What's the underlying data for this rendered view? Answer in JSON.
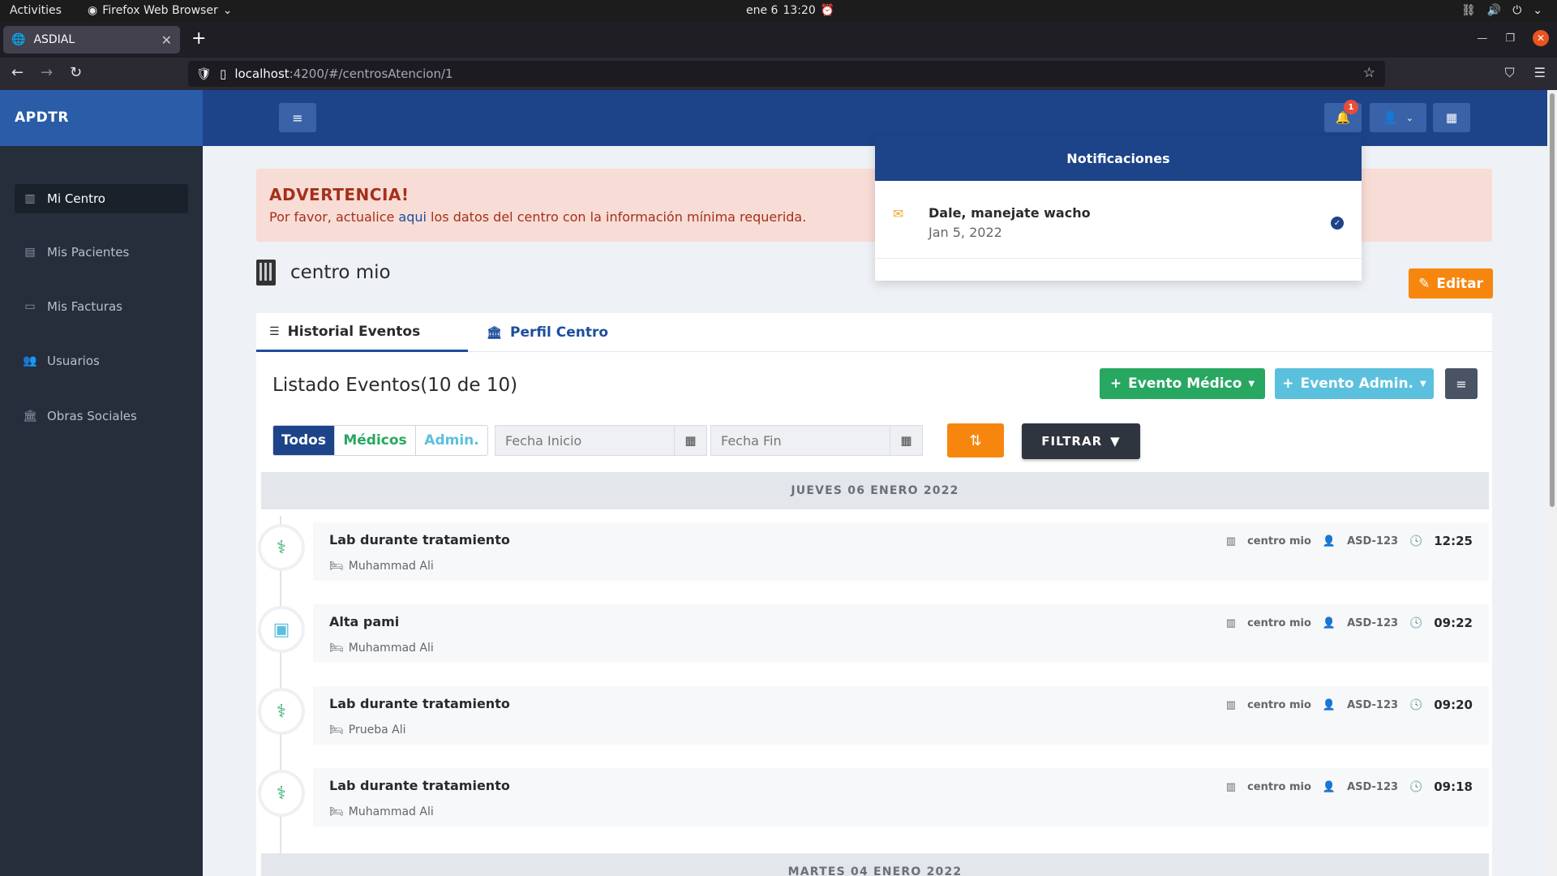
{
  "system": {
    "activities": "Activities",
    "app_name": "Firefox Web Browser",
    "date": "ene 6",
    "time": "13:20"
  },
  "browser": {
    "tab_title": "ASDIAL",
    "url_host": "localhost",
    "url_path": ":4200/#/centrosAtencion/1"
  },
  "header": {
    "brand": "APDTR",
    "notif_count": "1"
  },
  "sidebar": {
    "items": [
      {
        "label": "Mi Centro",
        "icon": "building-icon",
        "active": true
      },
      {
        "label": "Mis Pacientes",
        "icon": "id-card-icon",
        "active": false
      },
      {
        "label": "Mis Facturas",
        "icon": "credit-card-icon",
        "active": false
      },
      {
        "label": "Usuarios",
        "icon": "users-icon",
        "active": false
      },
      {
        "label": "Obras Sociales",
        "icon": "bank-icon",
        "active": false
      }
    ]
  },
  "alert": {
    "title": "ADVERTENCIA!",
    "msg_before": "Por favor, actualice ",
    "link": "aqui",
    "msg_after": " los datos del centro con la información mínima requerida."
  },
  "center": {
    "name": "centro mio",
    "edit_label": "Editar"
  },
  "tabs": {
    "historial": "Historial Eventos",
    "perfil": "Perfil Centro"
  },
  "list": {
    "title": "Listado Eventos(10 de 10)",
    "btn_medico": "Evento Médico",
    "btn_admin": "Evento Admin.",
    "filter_todos": "Todos",
    "filter_medicos": "Médicos",
    "filter_admin": "Admin.",
    "fecha_inicio_placeholder": "Fecha Inicio",
    "fecha_fin_placeholder": "Fecha Fin",
    "filtrar_label": "FILTRAR"
  },
  "days": [
    {
      "label": "JUEVES 06 ENERO 2022"
    },
    {
      "label": "MARTES 04 ENERO 2022"
    }
  ],
  "events": [
    {
      "title": "Lab durante tratamiento",
      "patient": "Muhammad Ali",
      "center": "centro mio",
      "code": "ASD-123",
      "time": "12:25",
      "type": "medico",
      "icon": "stethoscope-icon"
    },
    {
      "title": "Alta pami",
      "patient": "Muhammad Ali",
      "center": "centro mio",
      "code": "ASD-123",
      "time": "09:22",
      "type": "admin",
      "icon": "contact-card-icon"
    },
    {
      "title": "Lab durante tratamiento",
      "patient": "Prueba Ali",
      "center": "centro mio",
      "code": "ASD-123",
      "time": "09:20",
      "type": "medico",
      "icon": "stethoscope-icon"
    },
    {
      "title": "Lab durante tratamiento",
      "patient": "Muhammad Ali",
      "center": "centro mio",
      "code": "ASD-123",
      "time": "09:18",
      "type": "medico",
      "icon": "stethoscope-icon"
    }
  ],
  "notifications": {
    "header": "Notificaciones",
    "items": [
      {
        "title": "Dale, manejate wacho",
        "date": "Jan 5, 2022"
      }
    ]
  },
  "colors": {
    "primary": "#1d4389",
    "success": "#28a761",
    "info": "#5bc0de",
    "warning": "#f7860f",
    "danger_text": "#a5301a"
  }
}
